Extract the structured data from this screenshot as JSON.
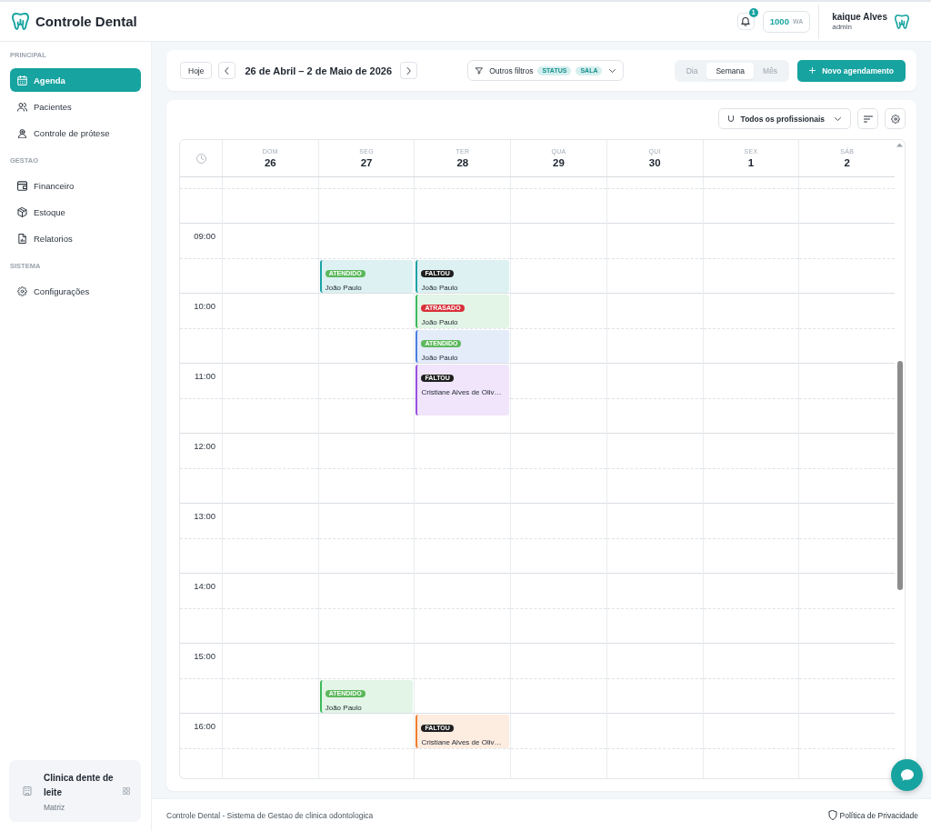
{
  "header": {
    "app_name": "Controle Dental",
    "notification_count": "1",
    "credits": {
      "amount": "1000",
      "unit": "WA"
    },
    "user": {
      "name": "kaique Alves",
      "role": "admin"
    }
  },
  "sidebar": {
    "sections": [
      {
        "title": "PRINCIPAL",
        "items": [
          {
            "label": "Agenda",
            "selected": true
          },
          {
            "label": "Pacientes",
            "selected": false
          },
          {
            "label": "Controle de prótese",
            "selected": false
          }
        ]
      },
      {
        "title": "GESTAO",
        "items": [
          {
            "label": "Financeiro",
            "selected": false
          },
          {
            "label": "Estoque",
            "selected": false
          },
          {
            "label": "Relatorios",
            "selected": false
          }
        ]
      },
      {
        "title": "SISTEMA",
        "items": [
          {
            "label": "Configurações",
            "selected": false
          }
        ]
      }
    ],
    "clinic": {
      "name": "Clinica dente de leite",
      "subtitle": "Matriz"
    }
  },
  "toolbar": {
    "today_button": "Hoje",
    "date_range": "26 de Abril – 2 de Maio de 2026",
    "filter": {
      "label": "Outros filtros",
      "tags": [
        "STATUS",
        "SALA"
      ]
    },
    "views": [
      {
        "label": "Dia",
        "selected": false
      },
      {
        "label": "Semana",
        "selected": true
      },
      {
        "label": "Mês",
        "selected": false
      }
    ],
    "new_button": "Novo agendamento"
  },
  "calendar": {
    "professional_filter": "Todos os profissionais",
    "hours": [
      "09:00",
      "10:00",
      "11:00",
      "12:00",
      "13:00",
      "14:00",
      "15:00",
      "16:00"
    ],
    "days": [
      {
        "weekday": "DOM",
        "date": "26"
      },
      {
        "weekday": "SEG",
        "date": "27",
        "slots": [
          {
            "kind": "free"
          },
          {
            "kind": "appointment",
            "status": {
              "label": "ATENDIDO",
              "kind": "attended"
            },
            "patient": "João Paulo",
            "color": "#1aa3a8",
            "extended": false
          },
          {
            "kind": "free"
          },
          {
            "kind": "free"
          },
          {
            "kind": "free"
          },
          {
            "kind": "free"
          },
          {
            "kind": "free"
          },
          {
            "kind": "free"
          },
          {
            "kind": "free"
          },
          {
            "kind": "free"
          },
          {
            "kind": "free"
          },
          {
            "kind": "free"
          },
          {
            "kind": "free"
          },
          {
            "kind": "appointment",
            "status": {
              "label": "ATENDIDO",
              "kind": "attended"
            },
            "patient": "João Paulo",
            "color": "#3cb95a",
            "extended": false
          }
        ]
      },
      {
        "weekday": "TER",
        "date": "28",
        "slots": [
          {
            "kind": "free"
          },
          {
            "kind": "appointment",
            "status": {
              "label": "FALTOU",
              "kind": "absent"
            },
            "patient": "João Paulo",
            "color": "#1aa3a8",
            "extended": false
          },
          {
            "kind": "appointment",
            "status": {
              "label": "ATRASADO",
              "kind": "late"
            },
            "patient": "João Paulo",
            "color": "#3cb95a",
            "extended": false
          },
          {
            "kind": "appointment",
            "status": {
              "label": "ATENDIDO",
              "kind": "attended"
            },
            "patient": "João Paulo",
            "color": "#4a7fe0",
            "extended": false
          },
          {
            "kind": "appointment",
            "status": {
              "label": "FALTOU",
              "kind": "absent"
            },
            "patient": "Cristiane Alves de Oliv…",
            "color": "#9b4fe0",
            "extended": true
          },
          {
            "kind": "free"
          },
          {
            "kind": "free"
          },
          {
            "kind": "free"
          },
          {
            "kind": "free"
          },
          {
            "kind": "free"
          },
          {
            "kind": "free"
          },
          {
            "kind": "free"
          },
          {
            "kind": "free"
          },
          {
            "kind": "free"
          },
          {
            "kind": "appointment",
            "status": {
              "label": "FALTOU",
              "kind": "absent"
            },
            "patient": "Cristiane Alves de Oliv…",
            "color": "#f07d2e",
            "extended": false
          }
        ]
      },
      {
        "weekday": "QUA",
        "date": "29"
      },
      {
        "weekday": "QUI",
        "date": "30"
      },
      {
        "weekday": "SEX",
        "date": "1"
      },
      {
        "weekday": "SÁB",
        "date": "2"
      }
    ]
  },
  "footer": {
    "text": "Controle Dental - Sistema de Gestao de clinica odontologica",
    "privacy_link": "Política de Privacidade"
  }
}
